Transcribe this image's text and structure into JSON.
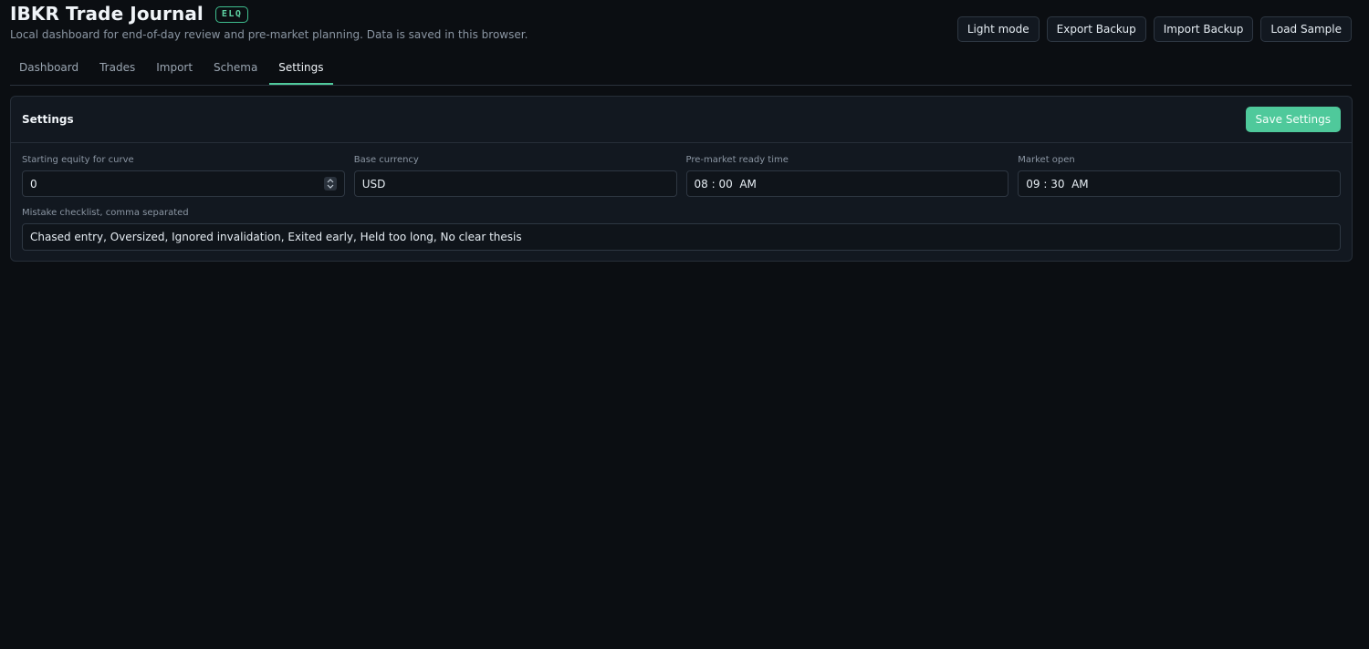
{
  "header": {
    "title": "IBKR Trade Journal",
    "badge": "ELQ",
    "subtitle": "Local dashboard for end-of-day review and pre-market planning. Data is saved in this browser.",
    "actions": [
      "Light mode",
      "Export Backup",
      "Import Backup",
      "Load Sample"
    ]
  },
  "tabs": [
    {
      "label": "Dashboard",
      "active": false
    },
    {
      "label": "Trades",
      "active": false
    },
    {
      "label": "Import",
      "active": false
    },
    {
      "label": "Schema",
      "active": false
    },
    {
      "label": "Settings",
      "active": true
    }
  ],
  "settings": {
    "title": "Settings",
    "save_label": "Save Settings",
    "fields": [
      {
        "label": "Starting equity for curve",
        "value": "0",
        "type": "number"
      },
      {
        "label": "Base currency",
        "value": "USD",
        "type": "text"
      },
      {
        "label": "Pre-market ready time",
        "value": "08 : 00  AM",
        "type": "time"
      },
      {
        "label": "Market open",
        "value": "09 : 30  AM",
        "type": "time"
      }
    ],
    "checklist": {
      "label": "Mistake checklist, comma separated",
      "value": "Chased entry, Oversized, Ignored invalidation, Exited early, Held too long, No clear thesis"
    }
  },
  "colors": {
    "background": "#0b0e12",
    "panel": "#121820",
    "accent": "#4fc99b",
    "border": "#2e3742"
  }
}
